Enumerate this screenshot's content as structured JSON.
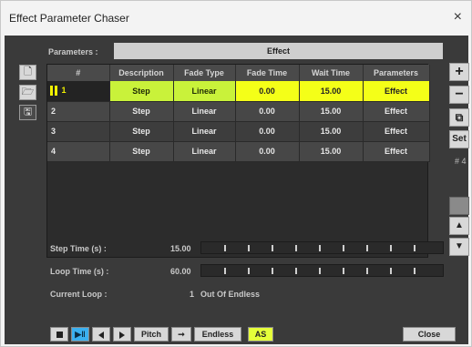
{
  "window": {
    "title": "Effect Parameter Chaser",
    "close_glyph": "×"
  },
  "parameters": {
    "label": "Parameters :",
    "value": "Effect"
  },
  "left_toolbar": [
    {
      "name": "new-icon",
      "glyph": "🗋"
    },
    {
      "name": "open-folder-icon",
      "glyph": "🗁"
    },
    {
      "name": "save-icon",
      "glyph": "🖫"
    }
  ],
  "table": {
    "headers": [
      "#",
      "Description",
      "Fade Type",
      "Fade Time",
      "Wait Time",
      "Parameters"
    ],
    "rows": [
      {
        "num": "1",
        "description": "Step",
        "fade_type": "Linear",
        "fade_time": "0.00",
        "wait_time": "15.00",
        "parameters": "Effect",
        "selected": true
      },
      {
        "num": "2",
        "description": "Step",
        "fade_type": "Linear",
        "fade_time": "0.00",
        "wait_time": "15.00",
        "parameters": "Effect",
        "selected": false
      },
      {
        "num": "3",
        "description": "Step",
        "fade_type": "Linear",
        "fade_time": "0.00",
        "wait_time": "15.00",
        "parameters": "Effect",
        "selected": false
      },
      {
        "num": "4",
        "description": "Step",
        "fade_type": "Linear",
        "fade_time": "0.00",
        "wait_time": "15.00",
        "parameters": "Effect",
        "selected": false
      }
    ]
  },
  "right_toolbar": {
    "add": "+",
    "remove": "−",
    "copy": "⧉",
    "set": "Set",
    "count": "# 4",
    "move_up": "▲",
    "move_down": "▼"
  },
  "step_time": {
    "label": "Step Time (s) :",
    "value": "15.00"
  },
  "loop_time": {
    "label": "Loop Time (s) :",
    "value": "60.00"
  },
  "current_loop": {
    "label": "Current Loop :",
    "value": "1",
    "suffix": "Out Of Endless"
  },
  "bottom_bar": {
    "pitch": "Pitch",
    "endless": "Endless",
    "as": "AS",
    "close": "Close"
  },
  "colors": {
    "selected_row": "#c9f23a",
    "highlight_yellow": "#f4ff18",
    "active_blue": "#3ab0f0",
    "panel_bg": "#3a3a3a"
  }
}
